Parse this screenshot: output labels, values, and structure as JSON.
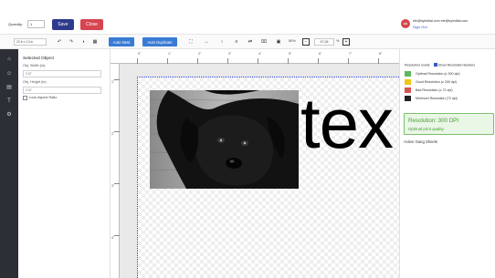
{
  "topbar": {
    "quantity_label": "Quantity:",
    "quantity_value": "1",
    "save_label": "Save",
    "close_label": "Close",
    "avatar_initials": "EB",
    "user_email": "efe@byiedital.com efe@byiedital.com",
    "sign_out_label": "Sign Out"
  },
  "toolbar": {
    "size_select": "20 in x 13 in",
    "auto_nest_label": "Auto Nest",
    "auto_duplicate_label": "Auto Duplicate",
    "zoom_display": "50%",
    "zoom_input": "47,06",
    "zoom_unit": "%"
  },
  "left_panel": {
    "title": "Selected Object",
    "width_label": "Obj. Width (in):",
    "width_value": "2.67",
    "height_label": "Obj. Height (in):",
    "height_value": "2.67",
    "lock_label": "Lock Aspect Ratio"
  },
  "canvas": {
    "ruler_top": [
      "0\"",
      "1\"",
      "2\"",
      "3\"",
      "4\"",
      "5\"",
      "6\"",
      "7\"",
      "8\""
    ],
    "ruler_left": [
      "1\"",
      "2\"",
      "3\"",
      "4\""
    ],
    "text_element": "tex"
  },
  "right_panel": {
    "guide_label": "Resolution Guide",
    "show_borders_label": "Show Resolution Borders",
    "legend": [
      {
        "label": "Optimal Resolution (≥ 300 dpi)",
        "color": "#5cb85c"
      },
      {
        "label": "Good Resolution (≥ 200 dpi)",
        "color": "#f0c419"
      },
      {
        "label": "Bad Resolution (≥ 72 dpi)",
        "color": "#d9534f"
      },
      {
        "label": "Minimum Resolution (72 dpi)",
        "color": "#222222"
      }
    ],
    "resolution_main": "Resolution: 300 DPI",
    "resolution_sub": "Optimal print quality",
    "gang_sheets_label": "Active Gang Sheets"
  },
  "icons": {
    "undo": "undo-icon",
    "redo": "redo-icon"
  },
  "colors": {
    "primary_navy": "#2e3a8c",
    "danger": "#d64550",
    "accent_blue": "#3a7bd5",
    "success": "#4a9a3a"
  }
}
